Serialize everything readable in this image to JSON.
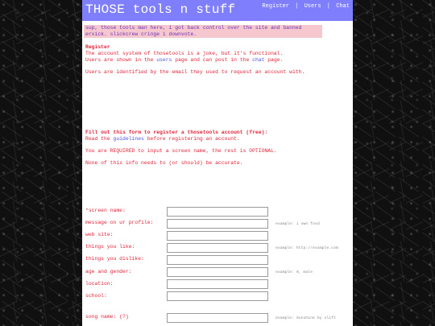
{
  "header": {
    "title": "THOSE tools n stuff",
    "nav": [
      {
        "label": "Register"
      },
      {
        "label": "Users"
      },
      {
        "label": "Chat"
      }
    ],
    "separator": "|"
  },
  "announcement": "sup, those tools man here, i got back control over the site and banned erxick. slickcrew cringe i downvote.",
  "register": {
    "heading": "Register",
    "line1": "The account system of thosetools is a joke, but it's functional.",
    "line2_pre": "Users are shown in the ",
    "line2_link": "users",
    "line2_mid": " page and can post in the ",
    "line2_link2": "chat",
    "line2_post": " page.",
    "line3": "Users are identified by the email they used to request an account with."
  },
  "form_intro": {
    "heading": "Fill out this form to register a thosetools account (free):",
    "read_pre": "Read the ",
    "read_link": "guidelines",
    "read_post": " before registering an account.",
    "required": "You are REQUIRED to input a screen name, the rest is OPTIONAL.",
    "accuracy": "None of this info needs to (or should) be accurate."
  },
  "form": {
    "fields": [
      {
        "label": "*screen name:",
        "value": "",
        "hint": ""
      },
      {
        "label": "message on ur profile:",
        "value": "",
        "hint": "example: i own food"
      },
      {
        "label": "web site:",
        "value": "",
        "hint": ""
      },
      {
        "label": "things you like:",
        "value": "",
        "hint": "example: http://example.com"
      },
      {
        "label": "things you dislike:",
        "value": "",
        "hint": ""
      },
      {
        "label": "age and gender:",
        "value": "",
        "hint": "example: 0, male"
      },
      {
        "label": "location:",
        "value": "",
        "hint": ""
      },
      {
        "label": "school:",
        "value": "",
        "hint": ""
      }
    ],
    "song": {
      "label": "song name: (?)",
      "value": "",
      "hint": "example: Sunshine by slift"
    }
  },
  "colors": {
    "header_bg": "#7f7ffd",
    "announce_bg": "#f6c7cf",
    "text_red": "#e0243a",
    "link_purple": "#4e52e2"
  }
}
